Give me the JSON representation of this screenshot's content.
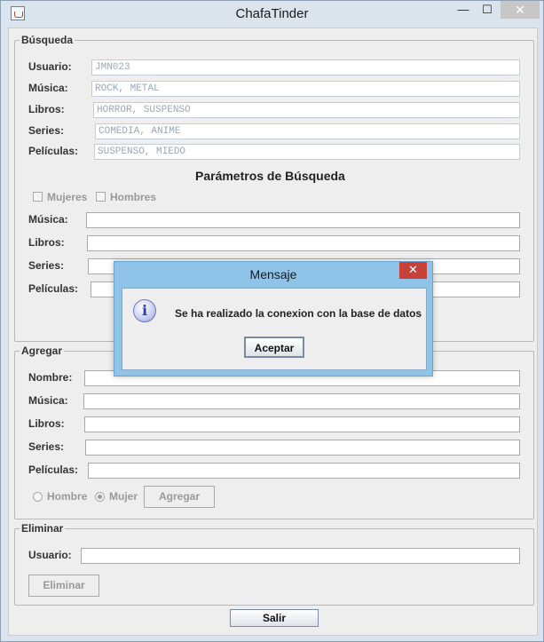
{
  "window": {
    "title": "ChafaTinder",
    "minimize": "—",
    "maximize": "☐",
    "close": "✕"
  },
  "busqueda": {
    "group_title": "Búsqueda",
    "usuario_label": "Usuario:",
    "usuario_value": "JMN023",
    "musica_label": "Música:",
    "musica_value": "ROCK, METAL",
    "libros_label": "Libros:",
    "libros_value": "HORROR, SUSPENSO",
    "series_label": "Series:",
    "series_value": "COMEDIA, ANIME",
    "peliculas_label": "Películas:",
    "peliculas_value": "SUSPENSO, MIEDO",
    "params_heading": "Parámetros de Búsqueda",
    "mujeres_label": "Mujeres",
    "hombres_label": "Hombres",
    "p_musica_label": "Música:",
    "p_libros_label": "Libros:",
    "p_series_label": "Series:",
    "p_peliculas_label": "Películas:"
  },
  "agregar": {
    "group_title": "Agregar",
    "nombre_label": "Nombre:",
    "musica_label": "Música:",
    "libros_label": "Libros:",
    "series_label": "Series:",
    "peliculas_label": "Películas:",
    "hombre_label": "Hombre",
    "mujer_label": "Mujer",
    "agregar_button": "Agregar"
  },
  "eliminar": {
    "group_title": "Eliminar",
    "usuario_label": "Usuario:",
    "eliminar_button": "Eliminar"
  },
  "salir_button": "Salir",
  "dialog": {
    "title": "Mensaje",
    "close": "✕",
    "icon": "i",
    "message": "Se ha realizado la conexion con la base de datos",
    "ok_button": "Aceptar"
  }
}
